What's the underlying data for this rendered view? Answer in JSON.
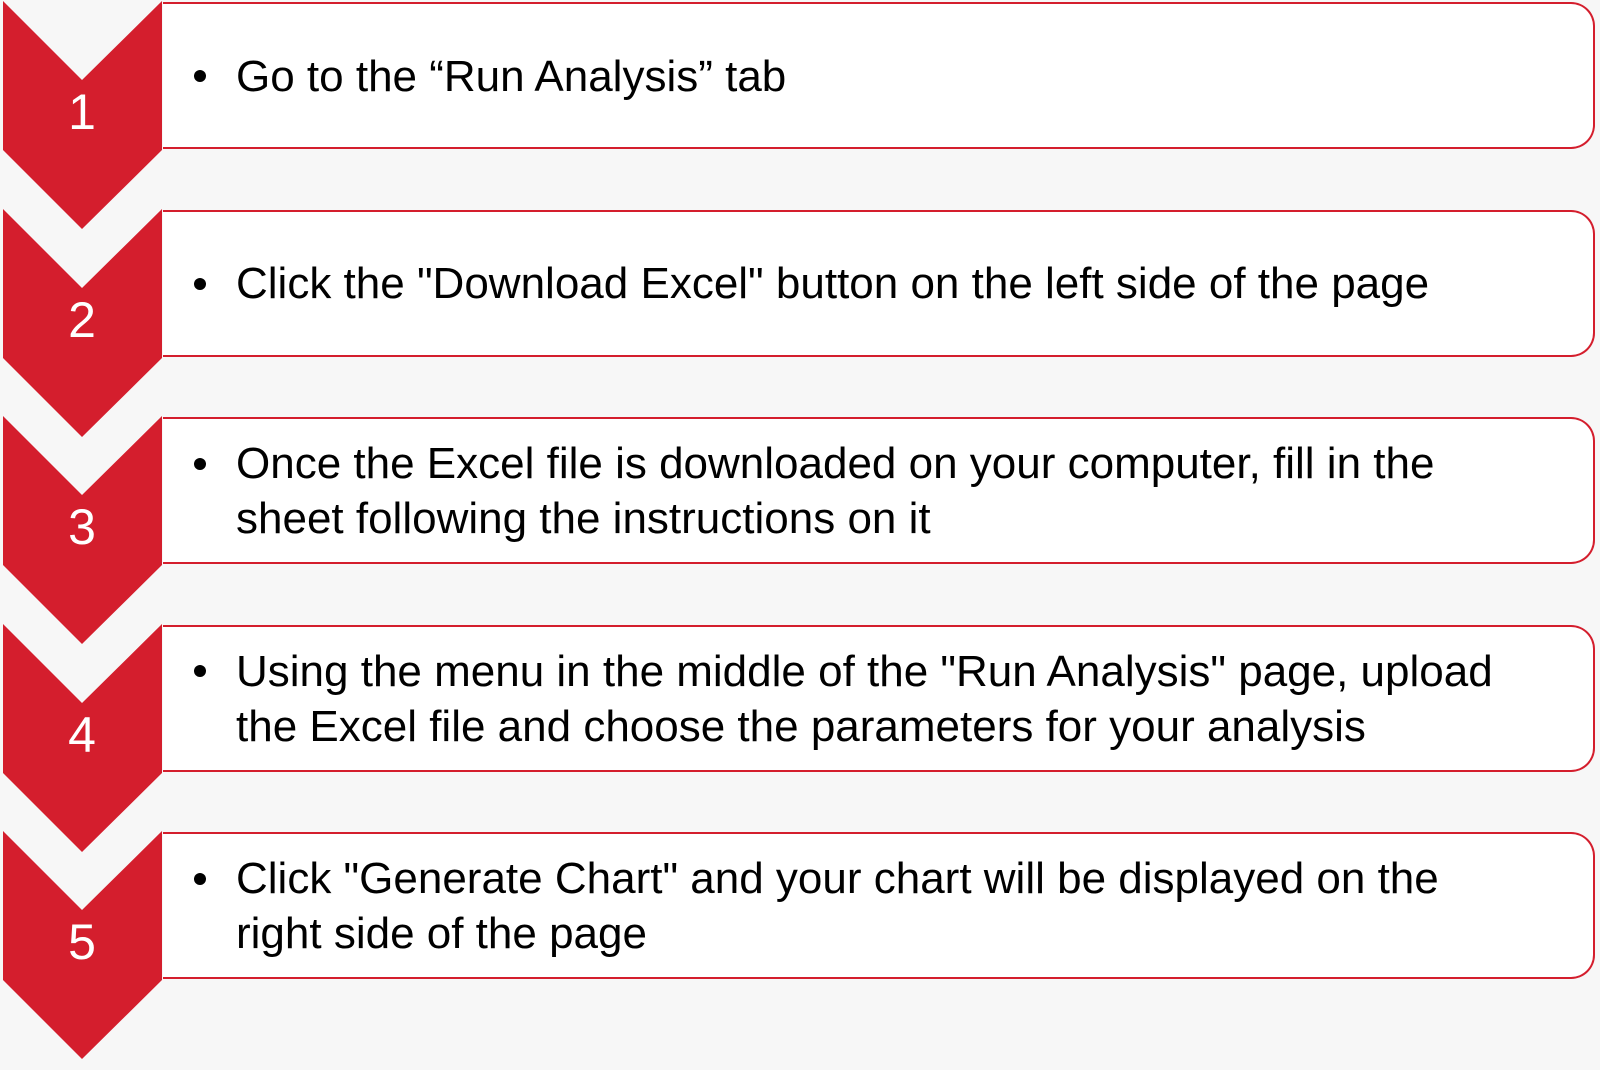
{
  "accent_color": "#d41e2d",
  "steps": [
    {
      "number": "1",
      "lines": [
        "Go to the “Run Analysis” tab"
      ]
    },
    {
      "number": "2",
      "lines": [
        "Click the \"Download Excel\" button on the left side of the page"
      ]
    },
    {
      "number": "3",
      "lines": [
        "Once the Excel file is downloaded on your computer, fill in the",
        "sheet following the instructions on it"
      ]
    },
    {
      "number": "4",
      "lines": [
        "Using the menu in the middle of the \"Run Analysis\" page, upload",
        "the Excel file and choose the parameters for your analysis"
      ]
    },
    {
      "number": "5",
      "lines": [
        "Click \"Generate Chart\" and your chart will be displayed on the",
        "right side of the page"
      ]
    }
  ]
}
